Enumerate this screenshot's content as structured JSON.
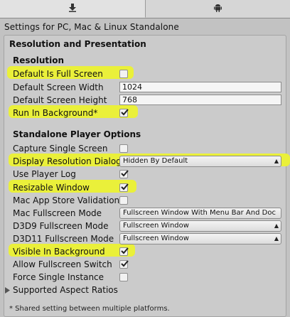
{
  "tabs": [
    {
      "name": "download-icon"
    },
    {
      "name": "android-icon"
    }
  ],
  "header": {
    "settings_for": "Settings for PC, Mac & Linux Standalone"
  },
  "panel": {
    "title": "Resolution and Presentation"
  },
  "resolution": {
    "title": "Resolution",
    "default_full_screen": {
      "label": "Default Is Full Screen",
      "checked": false
    },
    "screen_width": {
      "label": "Default Screen Width",
      "value": "1024"
    },
    "screen_height": {
      "label": "Default Screen Height",
      "value": "768"
    },
    "run_in_background": {
      "label": "Run In Background*",
      "checked": true
    }
  },
  "standalone": {
    "title": "Standalone Player Options",
    "capture_single_screen": {
      "label": "Capture Single Screen",
      "checked": false
    },
    "display_resolution_dialog": {
      "label": "Display Resolution Dialog",
      "value": "Hidden By Default"
    },
    "use_player_log": {
      "label": "Use Player Log",
      "checked": true
    },
    "resizable_window": {
      "label": "Resizable Window",
      "checked": true
    },
    "mac_app_store_validation": {
      "label": "Mac App Store Validation",
      "checked": false
    },
    "mac_fullscreen_mode": {
      "label": "Mac Fullscreen Mode",
      "value": "Fullscreen Window With Menu Bar And Doc"
    },
    "d3d9_fullscreen_mode": {
      "label": "D3D9 Fullscreen Mode",
      "value": "Fullscreen Window"
    },
    "d3d11_fullscreen_mode": {
      "label": "D3D11 Fullscreen Mode",
      "value": "Fullscreen Window"
    },
    "visible_in_background": {
      "label": "Visible In Background",
      "checked": true
    },
    "allow_fullscreen_switch": {
      "label": "Allow Fullscreen Switch",
      "checked": true
    },
    "force_single_instance": {
      "label": "Force Single Instance",
      "checked": false
    }
  },
  "supported_aspect_ratios": {
    "label": "Supported Aspect Ratios"
  },
  "footnote": "* Shared setting between multiple platforms.",
  "colors": {
    "highlight": "#eaf03a",
    "panel": "#cbcbcb",
    "background": "#c2c2c2"
  }
}
